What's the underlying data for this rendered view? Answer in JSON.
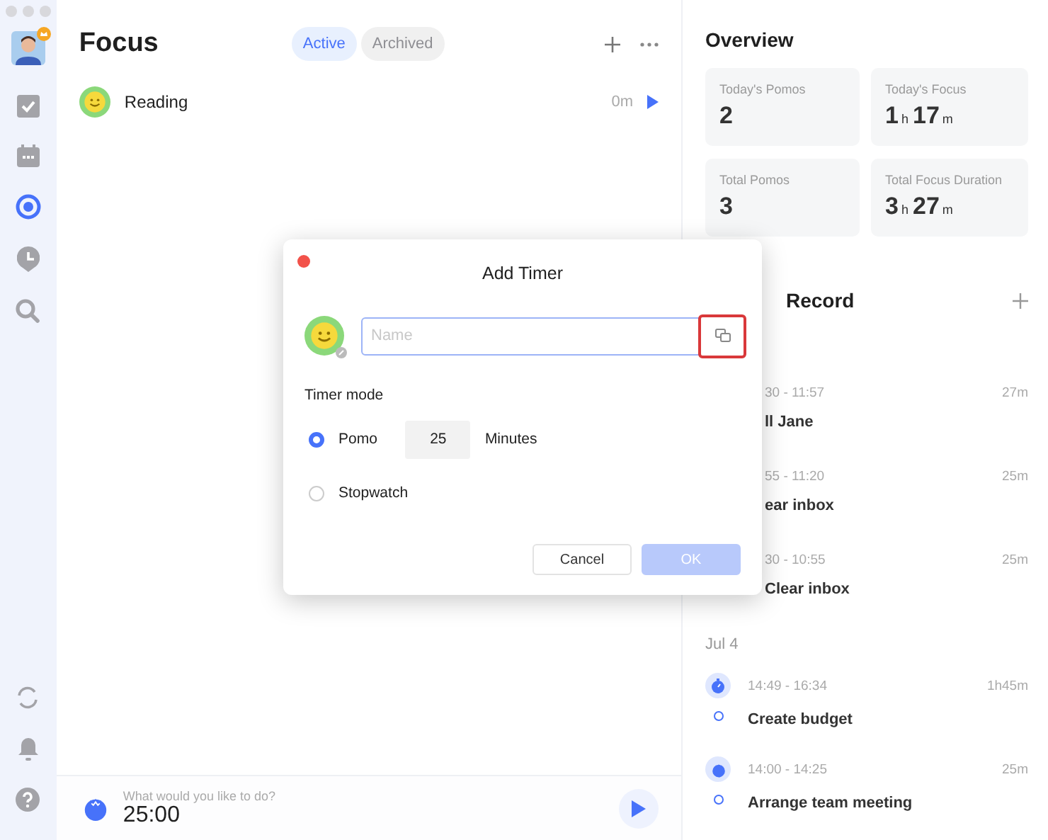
{
  "sidebar": {
    "items": [
      {
        "kind": "tasks",
        "selected": false
      },
      {
        "kind": "calendar",
        "selected": false
      },
      {
        "kind": "focus",
        "selected": true
      },
      {
        "kind": "habit",
        "selected": false
      },
      {
        "kind": "search",
        "selected": false
      }
    ],
    "bottom_items": [
      {
        "kind": "sync"
      },
      {
        "kind": "bell"
      },
      {
        "kind": "help"
      }
    ]
  },
  "focus": {
    "title": "Focus",
    "tabs": [
      {
        "label": "Active",
        "selected": true
      },
      {
        "label": "Archived",
        "selected": false
      }
    ],
    "timers": [
      {
        "name": "Reading",
        "duration": "0m"
      }
    ],
    "footer": {
      "prompt": "What would you like to do?",
      "time": "25:00"
    }
  },
  "overview": {
    "title": "Overview",
    "cards": [
      {
        "label": "Today's Pomos",
        "value": [
          {
            "text": "2",
            "kind": "number"
          }
        ]
      },
      {
        "label": "Today's Focus",
        "value": [
          {
            "text": "1",
            "kind": "number"
          },
          {
            "text": "h",
            "kind": "unit"
          },
          {
            "text": "17",
            "kind": "number"
          },
          {
            "text": "m",
            "kind": "unit"
          }
        ]
      },
      {
        "label": "Total Pomos",
        "value": [
          {
            "text": "3",
            "kind": "number"
          }
        ]
      },
      {
        "label": "Total Focus Duration",
        "value": [
          {
            "text": "3",
            "kind": "number"
          },
          {
            "text": "h",
            "kind": "unit"
          },
          {
            "text": "27",
            "kind": "number"
          },
          {
            "text": "m",
            "kind": "unit"
          }
        ]
      }
    ]
  },
  "record": {
    "title": "Record",
    "groups": [
      {
        "items": [
          {
            "time": "30 - 11:57",
            "duration": "27m",
            "title": "ll Jane"
          },
          {
            "time": "55 - 11:20",
            "duration": "25m",
            "title": "ear inbox"
          },
          {
            "time": "30 - 10:55",
            "duration": "25m",
            "title": "Clear inbox"
          }
        ]
      },
      {
        "date": "Jul 4",
        "items": [
          {
            "kind": "stopwatch",
            "time": "14:49 - 16:34",
            "duration": "1h45m",
            "title": "Create budget"
          },
          {
            "kind": "pomo",
            "time": "14:00 - 14:25",
            "duration": "25m",
            "title": "Arrange team meeting"
          }
        ]
      }
    ]
  },
  "dialog": {
    "title": "Add Timer",
    "name_field": {
      "placeholder": "Name"
    },
    "mode_label": "Timer mode",
    "modes": [
      {
        "label": "Pomo",
        "selected": true,
        "minutes": "25",
        "unit": "Minutes"
      },
      {
        "label": "Stopwatch",
        "selected": false
      }
    ],
    "buttons": [
      {
        "label": "Cancel",
        "kind": "secondary",
        "disabled": false
      },
      {
        "label": "OK",
        "kind": "primary",
        "disabled": true
      }
    ]
  }
}
